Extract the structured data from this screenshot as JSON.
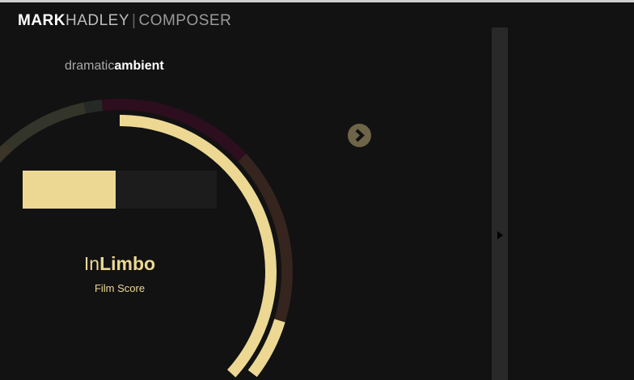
{
  "header": {
    "brand_bold": "MARK",
    "brand_light": "HADLEY",
    "separator": "|",
    "brand_sub": "COMPOSER"
  },
  "genre": {
    "light": "dramatic",
    "bold": "ambient"
  },
  "track": {
    "title_light": "In",
    "title_bold": "Limbo",
    "subtitle": "Film Score",
    "progress_percent": 48
  },
  "ring": {
    "outer_segments": [
      {
        "from_deg": -150,
        "to_deg": -41.5,
        "color": "#3a3528"
      },
      {
        "from_deg": -41.5,
        "to_deg": -12,
        "color": "#33342a"
      },
      {
        "from_deg": -12,
        "to_deg": -6,
        "color": "#262a26"
      },
      {
        "from_deg": -6,
        "to_deg": 47,
        "color": "#2c0e1e"
      },
      {
        "from_deg": 47,
        "to_deg": 107,
        "color": "#36241f"
      },
      {
        "from_deg": 107,
        "to_deg": 200,
        "color": "#ecd893"
      }
    ],
    "inner_arc": {
      "from_deg": 0,
      "to_deg": 200,
      "color": "#ecd893"
    }
  },
  "controls": {
    "next_icon": "chevron-right-icon",
    "panel_icon": "triangle-right-icon"
  },
  "colors": {
    "accent": "#ecd893",
    "background": "#121212",
    "panel": "#292929"
  }
}
